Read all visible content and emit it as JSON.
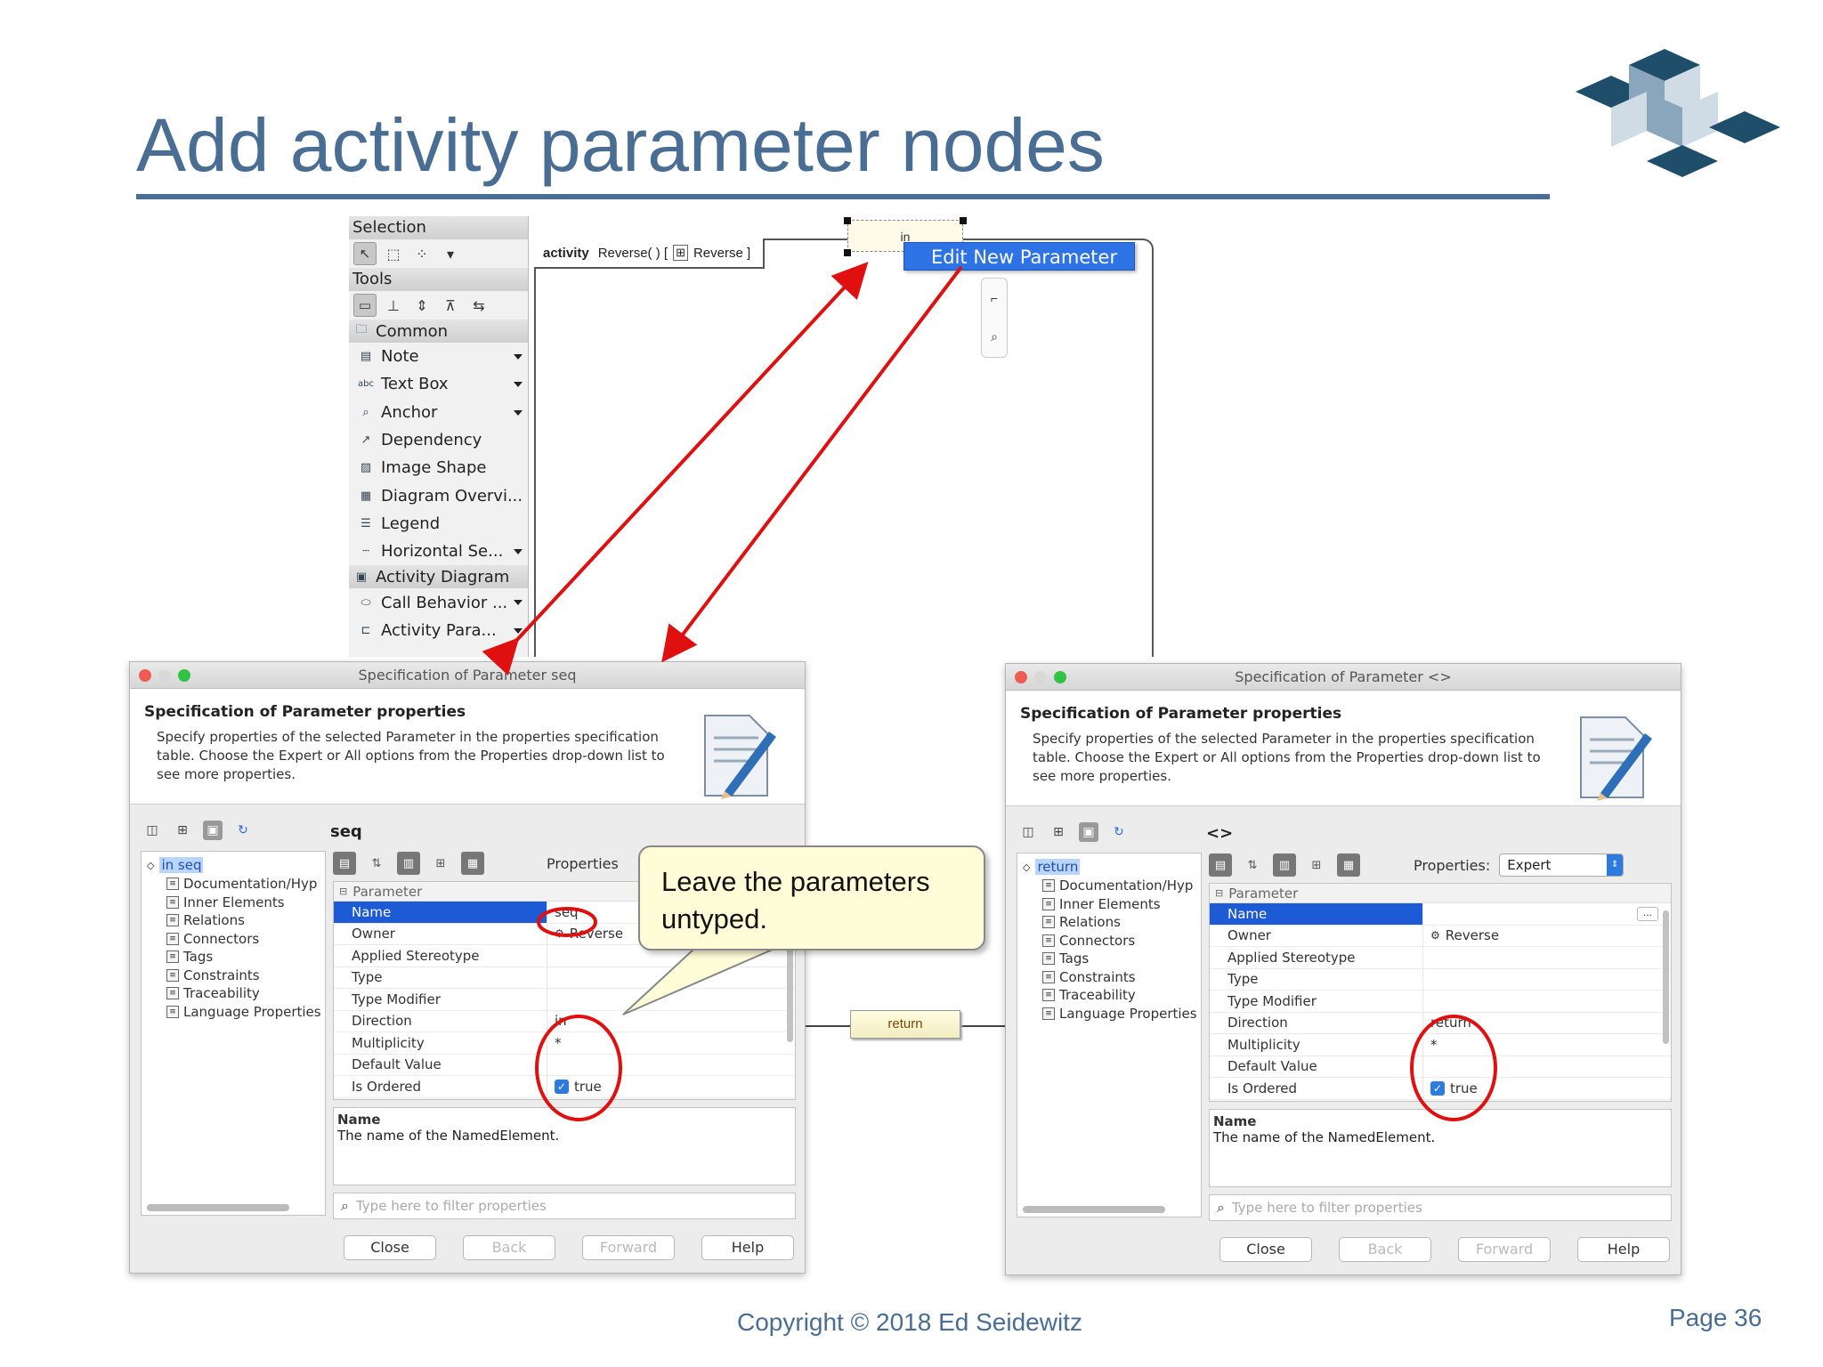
{
  "slide": {
    "title": "Add activity parameter nodes",
    "copyright": "Copyright © 2018 Ed Seidewitz",
    "page": "Page 36",
    "accent_color": "#4a6e93",
    "annotation_color": "#e01010"
  },
  "palette": {
    "selection_header": "Selection",
    "tools_header": "Tools",
    "common_section": "Common",
    "items": [
      {
        "label": "Note",
        "icon": "note-icon",
        "dropdown": true
      },
      {
        "label": "Text Box",
        "icon": "text-box-icon",
        "dropdown": true
      },
      {
        "label": "Anchor",
        "icon": "anchor-icon",
        "dropdown": true
      },
      {
        "label": "Dependency",
        "icon": "dependency-icon",
        "dropdown": false
      },
      {
        "label": "Image Shape",
        "icon": "image-icon",
        "dropdown": false
      },
      {
        "label": "Diagram Overvi...",
        "icon": "diagram-overview-icon",
        "dropdown": false
      },
      {
        "label": "Legend",
        "icon": "legend-icon",
        "dropdown": false
      },
      {
        "label": "Horizontal Se...",
        "icon": "separator-icon",
        "dropdown": true
      }
    ],
    "activity_section": "Activity Diagram",
    "activity_items": [
      {
        "label": "Call Behavior ...",
        "icon": "call-behavior-icon",
        "dropdown": true
      },
      {
        "label": "Activity Para...",
        "icon": "activity-parameter-icon",
        "dropdown": true
      }
    ]
  },
  "diagram": {
    "frame_keyword": "activity",
    "frame_name": "Reverse( ) [",
    "frame_ref": "Reverse ]",
    "param_node_label": "in",
    "context_menu_item": "Edit New Parameter",
    "return_node_label": "return"
  },
  "dialog_left": {
    "title": "Specification of Parameter seq",
    "heading": "Specification of Parameter properties",
    "description": "Specify properties of the selected Parameter in the properties specification table. Choose the Expert or All options from the Properties drop-down list to see more properties.",
    "selected_name": "seq",
    "tree_root": "in seq",
    "tree_items": [
      "Documentation/Hyp",
      "Inner Elements",
      "Relations",
      "Connectors",
      "Tags",
      "Constraints",
      "Traceability",
      "Language Properties"
    ],
    "properties_label": "Properties",
    "properties_value": "",
    "category": "Parameter",
    "rows": [
      {
        "key": "Name",
        "value": "seq"
      },
      {
        "key": "Owner",
        "value": "Reverse"
      },
      {
        "key": "Applied Stereotype",
        "value": ""
      },
      {
        "key": "Type",
        "value": ""
      },
      {
        "key": "Type Modifier",
        "value": ""
      },
      {
        "key": "Direction",
        "value": "in"
      },
      {
        "key": "Multiplicity",
        "value": "*"
      },
      {
        "key": "Default Value",
        "value": ""
      },
      {
        "key": "Is Ordered",
        "value": "true"
      }
    ],
    "desc_title": "Name",
    "desc_text": "The name of the NamedElement.",
    "filter_placeholder": "Type here to filter properties",
    "buttons": {
      "close": "Close",
      "back": "Back",
      "forward": "Forward",
      "help": "Help"
    }
  },
  "dialog_right": {
    "title": "Specification of Parameter <>",
    "heading": "Specification of Parameter properties",
    "description": "Specify properties of the selected Parameter in the properties specification table. Choose the Expert or All options from the Properties drop-down list to see more properties.",
    "selected_name": "<>",
    "tree_root": "return",
    "tree_items": [
      "Documentation/Hyp",
      "Inner Elements",
      "Relations",
      "Connectors",
      "Tags",
      "Constraints",
      "Traceability",
      "Language Properties"
    ],
    "properties_label": "Properties:",
    "properties_value": "Expert",
    "category": "Parameter",
    "rows": [
      {
        "key": "Name",
        "value": ""
      },
      {
        "key": "Owner",
        "value": "Reverse"
      },
      {
        "key": "Applied Stereotype",
        "value": ""
      },
      {
        "key": "Type",
        "value": ""
      },
      {
        "key": "Type Modifier",
        "value": ""
      },
      {
        "key": "Direction",
        "value": "return"
      },
      {
        "key": "Multiplicity",
        "value": "*"
      },
      {
        "key": "Default Value",
        "value": ""
      },
      {
        "key": "Is Ordered",
        "value": "true"
      }
    ],
    "desc_title": "Name",
    "desc_text": "The name of the NamedElement.",
    "filter_placeholder": "Type here to filter properties",
    "buttons": {
      "close": "Close",
      "back": "Back",
      "forward": "Forward",
      "help": "Help"
    }
  },
  "callout": {
    "line1": "Leave the parameters",
    "line2": "untyped."
  }
}
